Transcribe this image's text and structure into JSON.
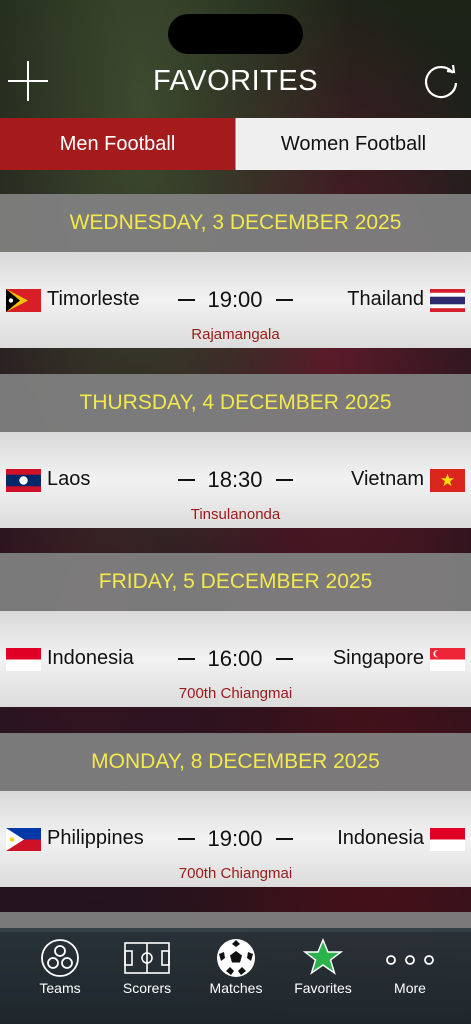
{
  "header": {
    "title": "FAVORITES"
  },
  "segments": {
    "men": "Men Football",
    "women": "Women Football"
  },
  "days": [
    {
      "label": "WEDNESDAY, 3 DECEMBER 2025",
      "match": {
        "home": "Timorleste",
        "away": "Thailand",
        "time": "19:00",
        "venue": "Rajamangala"
      }
    },
    {
      "label": "THURSDAY, 4 DECEMBER 2025",
      "match": {
        "home": "Laos",
        "away": "Vietnam",
        "time": "18:30",
        "venue": "Tinsulanonda"
      }
    },
    {
      "label": "FRIDAY, 5 DECEMBER 2025",
      "match": {
        "home": "Indonesia",
        "away": "Singapore",
        "time": "16:00",
        "venue": "700th Chiangmai"
      }
    },
    {
      "label": "MONDAY, 8 DECEMBER 2025",
      "match": {
        "home": "Philippines",
        "away": "Indonesia",
        "time": "19:00",
        "venue": "700th Chiangmai"
      }
    }
  ],
  "tabs": [
    {
      "label": "Teams",
      "icon": "teams-icon"
    },
    {
      "label": "Scorers",
      "icon": "pitch-icon"
    },
    {
      "label": "Matches",
      "icon": "soccer-ball-icon"
    },
    {
      "label": "Favorites",
      "icon": "star-icon"
    },
    {
      "label": "More",
      "icon": "more-dots-icon"
    }
  ],
  "colors": {
    "accent": "#a51a1a",
    "date_text": "#f4e94c",
    "venue_text": "#9b1a1a",
    "favorites_star": "#2bb24c"
  }
}
